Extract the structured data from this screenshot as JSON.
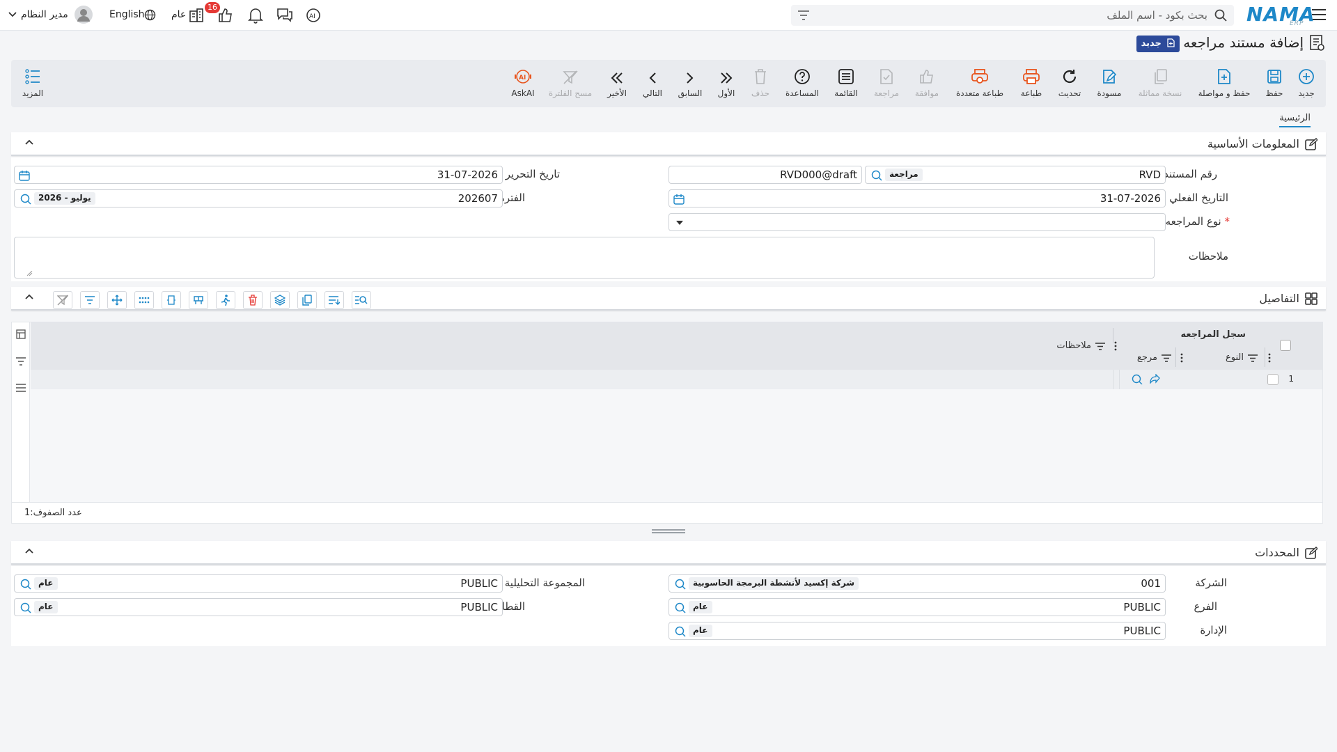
{
  "topbar": {
    "search_placeholder": "بحث بكود - اسم الملف",
    "logo_text": "NAMA",
    "logo_sub": "ERP",
    "user_name": "مدير النظام",
    "language": "English",
    "scope_label": "عام",
    "notif_count": "16"
  },
  "page": {
    "title": "إضافة مستند مراجعه",
    "status_badge": "جديد"
  },
  "toolbar": {
    "new": "جديد",
    "save": "حفظ",
    "save_continue": "حفظ و مواصلة",
    "copy": "نسخة مماثلة",
    "draft": "مسودة",
    "refresh": "تحديث",
    "print": "طباعة",
    "multi_print": "طباعة متعددة",
    "approve": "موافقة",
    "review": "مراجعة",
    "list": "القائمة",
    "help": "المساعدة",
    "delete": "حذف",
    "first": "الأول",
    "previous": "السابق",
    "next": "التالي",
    "last": "الأخير",
    "clear_filter": "مسح الفلترة",
    "ask_ai": "AskAI",
    "more": "المزيد"
  },
  "tabs": {
    "home": "الرئيسية"
  },
  "basic_info": {
    "title": "المعلومات الأساسية",
    "doc_number_label": "رقم المستند",
    "doc_number_value": "RVD",
    "doc_type_chip": "مراجعة",
    "doc_code": "RVD000@draft",
    "edit_date_label": "تاريخ التحرير",
    "edit_date_value": "31-07-2026",
    "actual_date_label": "التاريخ الفعلي",
    "actual_date_value": "31-07-2026",
    "period_label": "الفترة",
    "period_value": "202607",
    "period_chip": "2026 - يوليو",
    "review_type_label": "نوع المراجعه",
    "review_type_required": "*",
    "review_type_value": "",
    "notes_label": "ملاحظات",
    "notes_value": ""
  },
  "details": {
    "title": "التفاصيل",
    "group_header": "سجل المراجعه",
    "columns": {
      "type": "النوع",
      "reference": "مرجع",
      "notes": "ملاحظات"
    },
    "rows": [
      {
        "index": "1",
        "type": "",
        "reference": "",
        "notes": ""
      }
    ],
    "row_count_label": "عدد الصفوف:",
    "row_count_value": "1"
  },
  "dimensions": {
    "title": "المحددات",
    "company_label": "الشركة",
    "company_code": "001",
    "company_chip": "شركة إكسيد لأنشطة البرمجة الحاسوبية",
    "analysis_group_label": "المجموعة التحليلية",
    "analysis_group_code": "PUBLIC",
    "analysis_group_chip": "عام",
    "branch_label": "الفرع",
    "branch_code": "PUBLIC",
    "branch_chip": "عام",
    "sector_label": "القطاع",
    "sector_code": "PUBLIC",
    "sector_chip": "عام",
    "department_label": "الإدارة",
    "department_code": "PUBLIC",
    "department_chip": "عام"
  },
  "colors": {
    "accent": "#1e88c8",
    "badge_bg": "#2c4a9a",
    "print_orange": "#e8551e",
    "notif_red": "#e53935"
  }
}
